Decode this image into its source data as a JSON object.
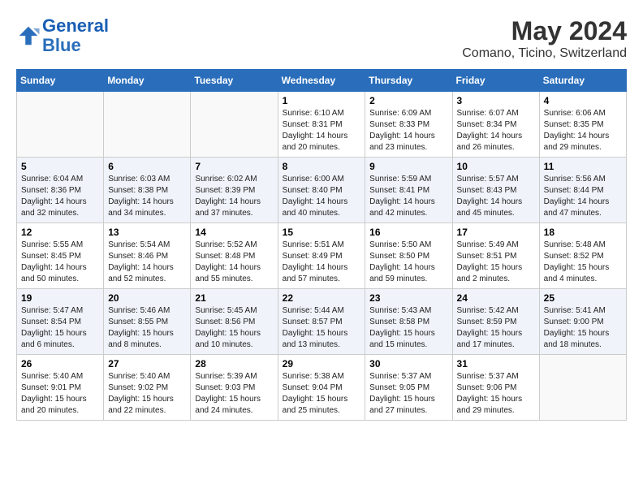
{
  "logo": {
    "line1": "General",
    "line2": "Blue"
  },
  "title": "May 2024",
  "subtitle": "Comano, Ticino, Switzerland",
  "days_header": [
    "Sunday",
    "Monday",
    "Tuesday",
    "Wednesday",
    "Thursday",
    "Friday",
    "Saturday"
  ],
  "weeks": [
    [
      {
        "num": "",
        "detail": ""
      },
      {
        "num": "",
        "detail": ""
      },
      {
        "num": "",
        "detail": ""
      },
      {
        "num": "1",
        "detail": "Sunrise: 6:10 AM\nSunset: 8:31 PM\nDaylight: 14 hours\nand 20 minutes."
      },
      {
        "num": "2",
        "detail": "Sunrise: 6:09 AM\nSunset: 8:33 PM\nDaylight: 14 hours\nand 23 minutes."
      },
      {
        "num": "3",
        "detail": "Sunrise: 6:07 AM\nSunset: 8:34 PM\nDaylight: 14 hours\nand 26 minutes."
      },
      {
        "num": "4",
        "detail": "Sunrise: 6:06 AM\nSunset: 8:35 PM\nDaylight: 14 hours\nand 29 minutes."
      }
    ],
    [
      {
        "num": "5",
        "detail": "Sunrise: 6:04 AM\nSunset: 8:36 PM\nDaylight: 14 hours\nand 32 minutes."
      },
      {
        "num": "6",
        "detail": "Sunrise: 6:03 AM\nSunset: 8:38 PM\nDaylight: 14 hours\nand 34 minutes."
      },
      {
        "num": "7",
        "detail": "Sunrise: 6:02 AM\nSunset: 8:39 PM\nDaylight: 14 hours\nand 37 minutes."
      },
      {
        "num": "8",
        "detail": "Sunrise: 6:00 AM\nSunset: 8:40 PM\nDaylight: 14 hours\nand 40 minutes."
      },
      {
        "num": "9",
        "detail": "Sunrise: 5:59 AM\nSunset: 8:41 PM\nDaylight: 14 hours\nand 42 minutes."
      },
      {
        "num": "10",
        "detail": "Sunrise: 5:57 AM\nSunset: 8:43 PM\nDaylight: 14 hours\nand 45 minutes."
      },
      {
        "num": "11",
        "detail": "Sunrise: 5:56 AM\nSunset: 8:44 PM\nDaylight: 14 hours\nand 47 minutes."
      }
    ],
    [
      {
        "num": "12",
        "detail": "Sunrise: 5:55 AM\nSunset: 8:45 PM\nDaylight: 14 hours\nand 50 minutes."
      },
      {
        "num": "13",
        "detail": "Sunrise: 5:54 AM\nSunset: 8:46 PM\nDaylight: 14 hours\nand 52 minutes."
      },
      {
        "num": "14",
        "detail": "Sunrise: 5:52 AM\nSunset: 8:48 PM\nDaylight: 14 hours\nand 55 minutes."
      },
      {
        "num": "15",
        "detail": "Sunrise: 5:51 AM\nSunset: 8:49 PM\nDaylight: 14 hours\nand 57 minutes."
      },
      {
        "num": "16",
        "detail": "Sunrise: 5:50 AM\nSunset: 8:50 PM\nDaylight: 14 hours\nand 59 minutes."
      },
      {
        "num": "17",
        "detail": "Sunrise: 5:49 AM\nSunset: 8:51 PM\nDaylight: 15 hours\nand 2 minutes."
      },
      {
        "num": "18",
        "detail": "Sunrise: 5:48 AM\nSunset: 8:52 PM\nDaylight: 15 hours\nand 4 minutes."
      }
    ],
    [
      {
        "num": "19",
        "detail": "Sunrise: 5:47 AM\nSunset: 8:54 PM\nDaylight: 15 hours\nand 6 minutes."
      },
      {
        "num": "20",
        "detail": "Sunrise: 5:46 AM\nSunset: 8:55 PM\nDaylight: 15 hours\nand 8 minutes."
      },
      {
        "num": "21",
        "detail": "Sunrise: 5:45 AM\nSunset: 8:56 PM\nDaylight: 15 hours\nand 10 minutes."
      },
      {
        "num": "22",
        "detail": "Sunrise: 5:44 AM\nSunset: 8:57 PM\nDaylight: 15 hours\nand 13 minutes."
      },
      {
        "num": "23",
        "detail": "Sunrise: 5:43 AM\nSunset: 8:58 PM\nDaylight: 15 hours\nand 15 minutes."
      },
      {
        "num": "24",
        "detail": "Sunrise: 5:42 AM\nSunset: 8:59 PM\nDaylight: 15 hours\nand 17 minutes."
      },
      {
        "num": "25",
        "detail": "Sunrise: 5:41 AM\nSunset: 9:00 PM\nDaylight: 15 hours\nand 18 minutes."
      }
    ],
    [
      {
        "num": "26",
        "detail": "Sunrise: 5:40 AM\nSunset: 9:01 PM\nDaylight: 15 hours\nand 20 minutes."
      },
      {
        "num": "27",
        "detail": "Sunrise: 5:40 AM\nSunset: 9:02 PM\nDaylight: 15 hours\nand 22 minutes."
      },
      {
        "num": "28",
        "detail": "Sunrise: 5:39 AM\nSunset: 9:03 PM\nDaylight: 15 hours\nand 24 minutes."
      },
      {
        "num": "29",
        "detail": "Sunrise: 5:38 AM\nSunset: 9:04 PM\nDaylight: 15 hours\nand 25 minutes."
      },
      {
        "num": "30",
        "detail": "Sunrise: 5:37 AM\nSunset: 9:05 PM\nDaylight: 15 hours\nand 27 minutes."
      },
      {
        "num": "31",
        "detail": "Sunrise: 5:37 AM\nSunset: 9:06 PM\nDaylight: 15 hours\nand 29 minutes."
      },
      {
        "num": "",
        "detail": ""
      }
    ]
  ]
}
